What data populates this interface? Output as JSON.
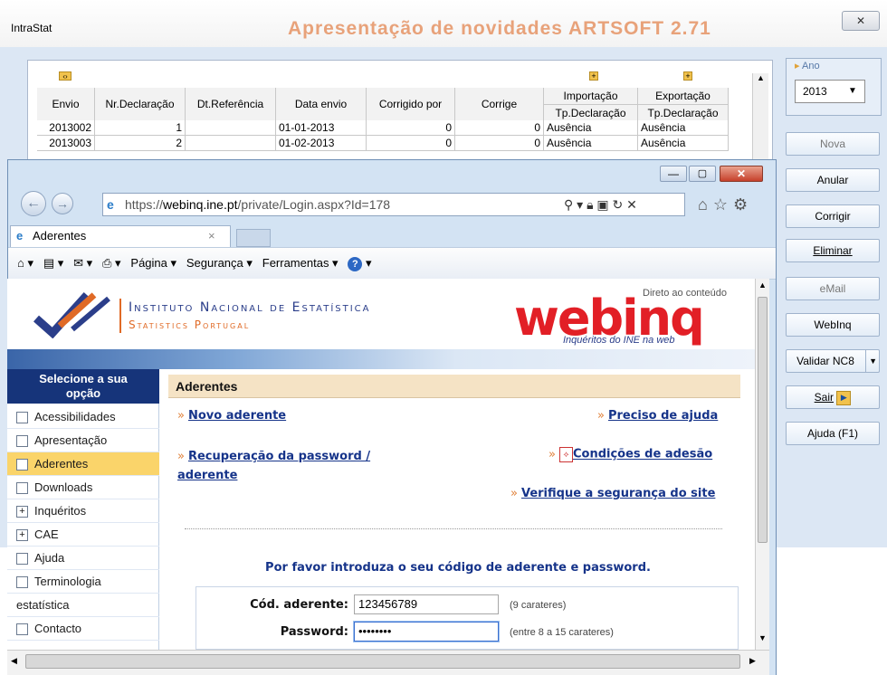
{
  "intrastat": {
    "title": "IntraStat",
    "banner": "Apresentação de novidades ARTSOFT 2.71",
    "close_glyph": "✕",
    "table": {
      "group_headers": [
        "Importação",
        "Exportação"
      ],
      "columns": [
        "Envio",
        "Nr.Declaração",
        "Dt.Referência",
        "Data envio",
        "Corrigido por",
        "Corrige",
        "Tp.Declaração",
        "Tp.Declaração"
      ],
      "rows": [
        [
          "2013002",
          "1",
          "",
          "01-01-2013",
          "0",
          "0",
          "Ausência",
          "Ausência"
        ],
        [
          "2013003",
          "2",
          "",
          "01-02-2013",
          "0",
          "0",
          "Ausência",
          "Ausência"
        ]
      ]
    },
    "ano_label": "Ano",
    "ano_value": "2013",
    "buttons": {
      "nova": "Nova",
      "anular": "Anular",
      "corrigir": "Corrigir",
      "eliminar": "Eliminar",
      "email": "eMail",
      "webinq": "WebInq",
      "validar": "Validar NC8",
      "sair": "Sair",
      "ajuda": "Ajuda (F1)"
    }
  },
  "ie": {
    "address_prefix": "https://",
    "address_domain": "webinq.ine.pt",
    "address_path": "/private/Login.aspx?Id=178",
    "tab_title": "Aderentes",
    "tab_close": "×",
    "toolbar": {
      "pagina": "Página ▾",
      "seguranca": "Segurança ▾",
      "ferramentas": "Ferramentas ▾"
    }
  },
  "site": {
    "ine_name": "Instituto Nacional de Estatística",
    "ine_sub": "Statistics Portugal",
    "direto": "Direto ao conteúdo",
    "webinq_logo": "webinq",
    "webinq_tagline": "Inquéritos do INE na web",
    "sidebar_title_line1": "Selecione a sua",
    "sidebar_title_line2": "opção",
    "sidebar_items": [
      {
        "label": "Acessibilidades",
        "marker": ""
      },
      {
        "label": "Apresentação",
        "marker": ""
      },
      {
        "label": "Aderentes",
        "marker": ""
      },
      {
        "label": "Downloads",
        "marker": ""
      },
      {
        "label": "Inquéritos",
        "marker": "+"
      },
      {
        "label": "CAE",
        "marker": "+"
      },
      {
        "label": "Ajuda",
        "marker": ""
      },
      {
        "label": "Terminologia",
        "marker": ""
      },
      {
        "label": "estatística",
        "marker": ""
      },
      {
        "label": "Contacto",
        "marker": ""
      }
    ],
    "page_heading": "Aderentes",
    "links": {
      "novo_aderente": "Novo aderente",
      "preciso_ajuda": "Preciso de ajuda",
      "recuperacao_line1": "Recuperação da password /",
      "recuperacao_line2": "aderente",
      "condicoes": "Condições de adesão",
      "verifique": "Verifique a segurança do site"
    },
    "intro": "Por favor introduza o seu código de aderente e password.",
    "form": {
      "cod_label": "Cód. aderente:",
      "cod_value": "123456789",
      "cod_hint": "(9 carateres)",
      "pwd_label": "Password:",
      "pwd_value": "••••••••",
      "pwd_hint": "(entre 8 a 15 carateres)"
    }
  }
}
